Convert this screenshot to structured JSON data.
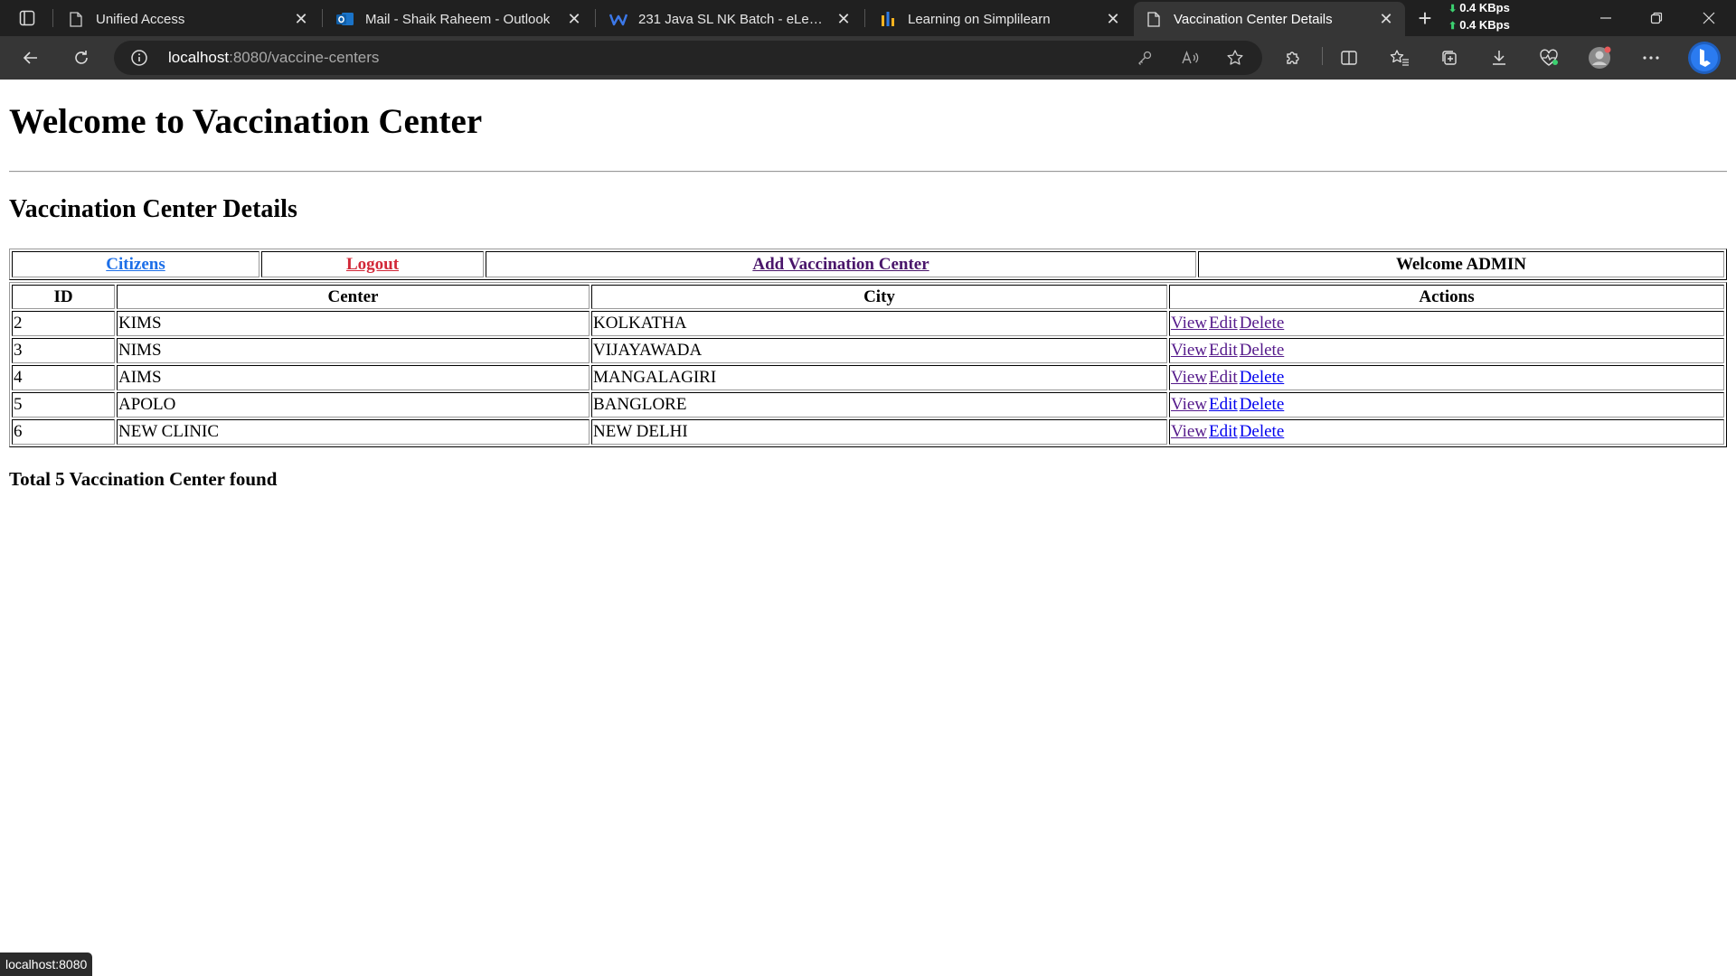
{
  "browser": {
    "tabs": [
      {
        "title": "Unified Access",
        "icon": "page-icon",
        "active": false
      },
      {
        "title": "Mail - Shaik Raheem - Outlook",
        "icon": "outlook-icon",
        "active": false
      },
      {
        "title": "231 Java SL NK Batch - eLearning",
        "icon": "webex-icon",
        "active": false
      },
      {
        "title": "Learning on Simplilearn",
        "icon": "simplilearn-icon",
        "active": false
      },
      {
        "title": "Vaccination Center Details",
        "icon": "page-icon",
        "active": true
      }
    ],
    "net_speed": {
      "down": "0.4 KBps",
      "up": "0.4 KBps"
    },
    "address": {
      "host": "localhost",
      "path": ":8080/vaccine-centers"
    },
    "status_url": "localhost:8080"
  },
  "page": {
    "heading": "Welcome to Vaccination Center",
    "section_title": "Vaccination Center Details",
    "nav": {
      "citizens": "Citizens",
      "logout": "Logout",
      "add_center": "Add Vaccination Center",
      "welcome": "Welcome ADMIN"
    },
    "table": {
      "headers": [
        "ID",
        "Center",
        "City",
        "Actions"
      ],
      "rows": [
        {
          "id": "2",
          "center": "KIMS",
          "city": "KOLKATHA"
        },
        {
          "id": "3",
          "center": "NIMS",
          "city": "VIJAYAWADA"
        },
        {
          "id": "4",
          "center": "AIMS",
          "city": "MANGALAGIRI"
        },
        {
          "id": "5",
          "center": "APOLO",
          "city": "BANGLORE"
        },
        {
          "id": "6",
          "center": "NEW CLINIC",
          "city": "NEW DELHI"
        }
      ],
      "actions": {
        "view": "View",
        "edit": "Edit",
        "delete": "Delete"
      }
    },
    "total": "Total 5 Vaccination Center found"
  }
}
